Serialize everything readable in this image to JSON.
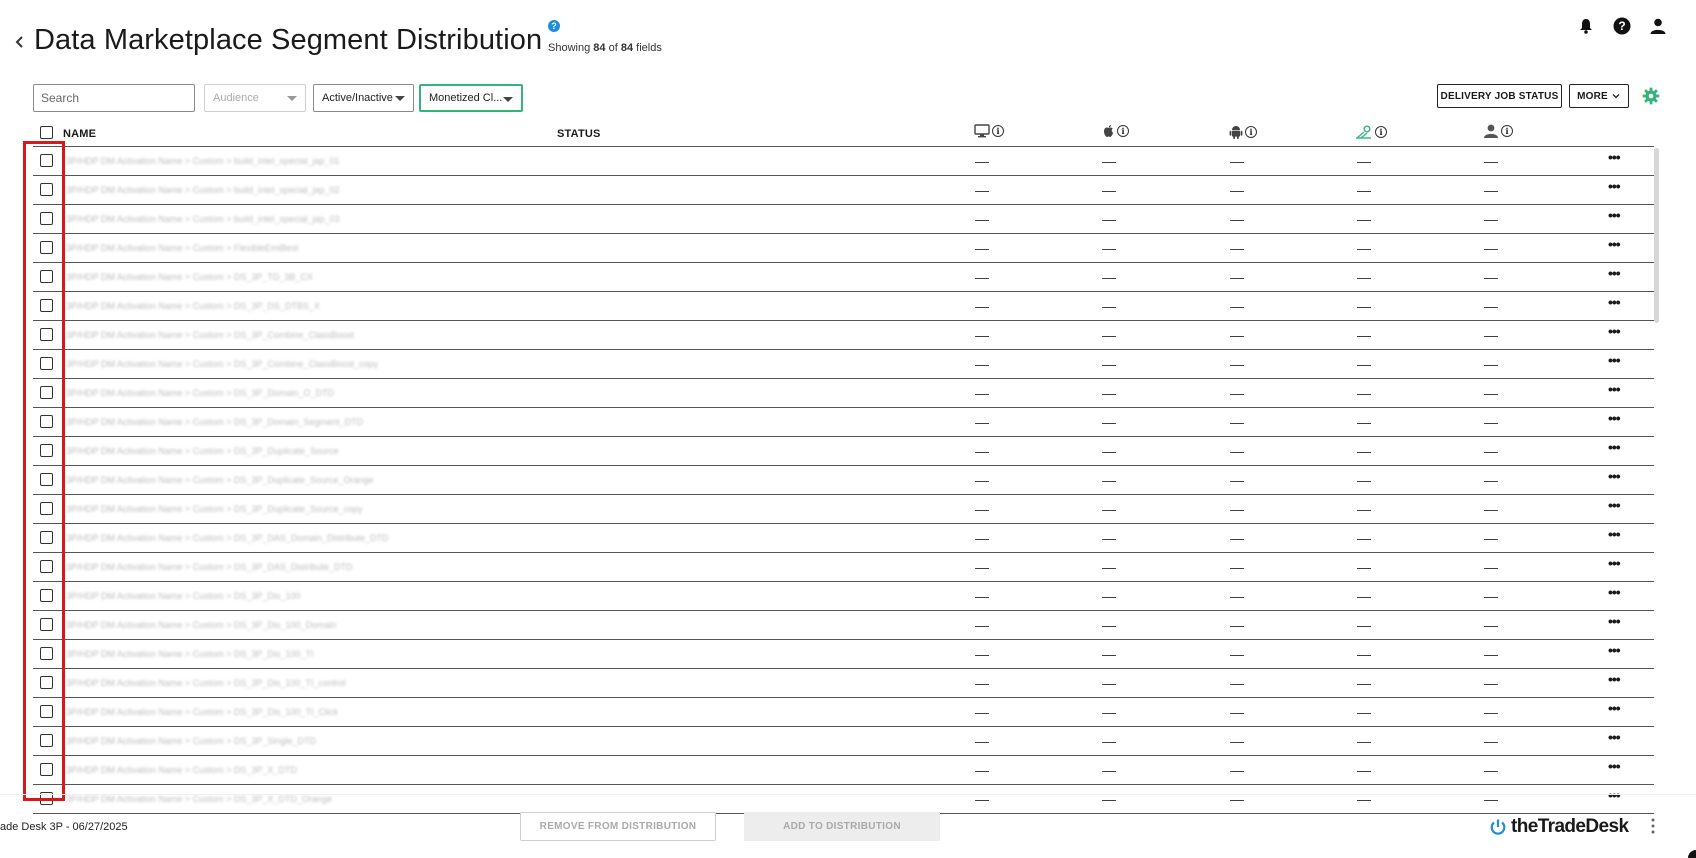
{
  "header": {
    "title": "Data Marketplace Segment Distribution",
    "help_glyph": "?",
    "showing_prefix": "Showing",
    "showing_count": "84",
    "showing_of": "of",
    "showing_total": "84",
    "showing_suffix": "fields",
    "icons": [
      "bell-icon",
      "help-icon",
      "user-icon"
    ]
  },
  "toolbar": {
    "search_placeholder": "Search",
    "audience_label": "Audience",
    "status_filter_label": "Active/Inactive",
    "monetized_filter_label": "Monetized Cl...",
    "delivery_button": "DELIVERY JOB STATUS",
    "more_button": "MORE",
    "accent_color": "#35b37e"
  },
  "table": {
    "columns": {
      "name": "NAME",
      "status": "STATUS",
      "desktop_icon": "desktop-icon",
      "ios_icon": "apple-icon",
      "android_icon": "android-icon",
      "ctv_icon": "ctv-icon",
      "person_icon": "person-icon",
      "info_glyph": "i"
    },
    "dash": "—",
    "more_glyph": "•••",
    "rows": [
      {
        "name": "3P/HDP DM Activation Name > Custom > build_intel_special_jap_01"
      },
      {
        "name": "3P/HDP DM Activation Name > Custom > build_intel_special_jap_02"
      },
      {
        "name": "3P/HDP DM Activation Name > Custom > build_intel_special_jap_03"
      },
      {
        "name": "3P/HDP DM Activation Name > Custom > FlexibleEmiBest"
      },
      {
        "name": "3P/HDP DM Activation Name > Custom > DS_3P_TD_3B_CX"
      },
      {
        "name": "3P/HDP DM Activation Name > Custom > DS_3P_DS_DTBS_X"
      },
      {
        "name": "3P/HDP DM Activation Name > Custom > DS_3P_Combine_ClassBoost"
      },
      {
        "name": "3P/HDP DM Activation Name > Custom > DS_3P_Combine_ClassBoost_copy"
      },
      {
        "name": "3P/HDP DM Activation Name > Custom > DS_3P_Domain_O_DTD"
      },
      {
        "name": "3P/HDP DM Activation Name > Custom > DS_3P_Domain_Segment_DTD"
      },
      {
        "name": "3P/HDP DM Activation Name > Custom > DS_3P_Duplicate_Source"
      },
      {
        "name": "3P/HDP DM Activation Name > Custom > DS_3P_Duplicate_Source_Orange"
      },
      {
        "name": "3P/HDP DM Activation Name > Custom > DS_3P_Duplicate_Source_copy"
      },
      {
        "name": "3P/HDP DM Activation Name > Custom > DS_3P_DAS_Domain_Distribute_DTD"
      },
      {
        "name": "3P/HDP DM Activation Name > Custom > DS_3P_DAS_Distribute_DTD"
      },
      {
        "name": "3P/HDP DM Activation Name > Custom > DS_3P_Dis_100"
      },
      {
        "name": "3P/HDP DM Activation Name > Custom > DS_3P_Dis_100_Domain"
      },
      {
        "name": "3P/HDP DM Activation Name > Custom > DS_3P_Dis_100_TI"
      },
      {
        "name": "3P/HDP DM Activation Name > Custom > DS_3P_Dis_100_TI_control"
      },
      {
        "name": "3P/HDP DM Activation Name > Custom > DS_3P_Dis_100_TI_Click"
      },
      {
        "name": "3P/HDP DM Activation Name > Custom > DS_3P_Single_DTD"
      },
      {
        "name": "3P/HDP DM Activation Name > Custom > DS_3P_X_DTD"
      },
      {
        "name": "3P/HDP DM Activation Name > Custom > DS_3P_X_DTD_Orange"
      }
    ]
  },
  "footer": {
    "left_text": "ade Desk 3P - 06/27/2025",
    "remove_button": "REMOVE FROM DISTRIBUTION",
    "add_button": "ADD TO DISTRIBUTION",
    "logo_text": "theTradeDesk",
    "logo_color": "#1e8fd5"
  },
  "highlight_color": "#d7191c"
}
